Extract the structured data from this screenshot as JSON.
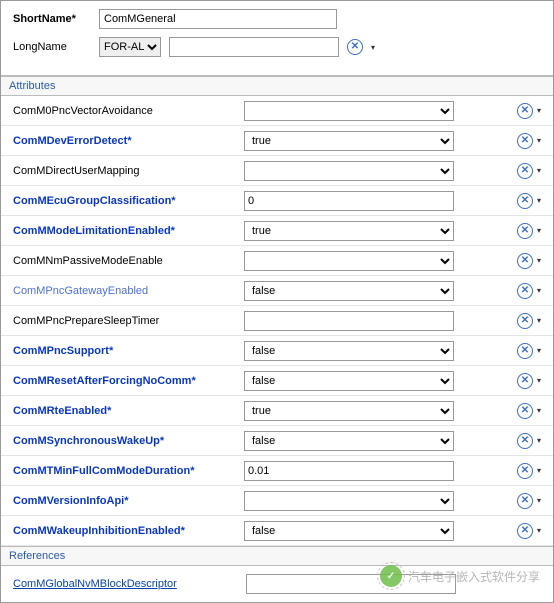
{
  "header": {
    "shortNameLabel": "ShortName*",
    "shortNameValue": "ComMGeneral",
    "longNameLabel": "LongName",
    "longNameSelect": "FOR-ALL",
    "longNameValue": ""
  },
  "sections": {
    "attributes": "Attributes",
    "references": "References"
  },
  "attributes": [
    {
      "label": "ComM0PncVectorAvoidance",
      "style": "normal",
      "type": "select",
      "value": ""
    },
    {
      "label": "ComMDevErrorDetect*",
      "style": "req",
      "type": "select",
      "value": "true"
    },
    {
      "label": "ComMDirectUserMapping",
      "style": "normal",
      "type": "select",
      "value": ""
    },
    {
      "label": "ComMEcuGroupClassification*",
      "style": "req",
      "type": "text",
      "value": "0"
    },
    {
      "label": "ComMModeLimitationEnabled*",
      "style": "req",
      "type": "select",
      "value": "true"
    },
    {
      "label": "ComMNmPassiveModeEnable",
      "style": "normal",
      "type": "select",
      "value": ""
    },
    {
      "label": "ComMPncGatewayEnabled",
      "style": "ghost",
      "type": "select",
      "value": "false"
    },
    {
      "label": "ComMPncPrepareSleepTimer",
      "style": "normal",
      "type": "text",
      "value": ""
    },
    {
      "label": "ComMPncSupport*",
      "style": "req",
      "type": "select",
      "value": "false"
    },
    {
      "label": "ComMResetAfterForcingNoComm*",
      "style": "req",
      "type": "select",
      "value": "false"
    },
    {
      "label": "ComMRteEnabled*",
      "style": "req",
      "type": "select",
      "value": "true"
    },
    {
      "label": "ComMSynchronousWakeUp*",
      "style": "req",
      "type": "select",
      "value": "false"
    },
    {
      "label": "ComMTMinFullComModeDuration*",
      "style": "req",
      "type": "text",
      "value": "0.01"
    },
    {
      "label": "ComMVersionInfoApi*",
      "style": "req",
      "type": "select",
      "value": ""
    },
    {
      "label": "ComMWakeupInhibitionEnabled*",
      "style": "req",
      "type": "select",
      "value": "false"
    }
  ],
  "references": {
    "label": "ComMGlobalNvMBlockDescriptor",
    "value": ""
  },
  "icons": {
    "reset": "✕",
    "dropdown": "▾"
  },
  "watermark": {
    "logo": "微信",
    "text": "汽车电子嵌入式软件分享"
  }
}
